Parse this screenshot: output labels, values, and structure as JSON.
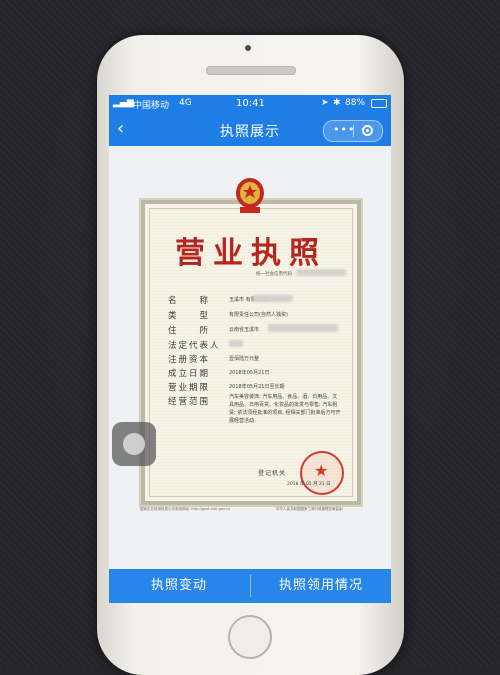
{
  "status": {
    "carrier": "中国移动",
    "network": "4G",
    "time": "10:41",
    "battery": "88%"
  },
  "nav": {
    "back": "‹",
    "title": "执照展示",
    "menu_dots": "•••"
  },
  "certificate": {
    "title": "营业执照",
    "credit_label": "统一社会信用代码",
    "rows": [
      {
        "label": "名　　称",
        "value": "玉溪市                    有限公司"
      },
      {
        "label": "类　　型",
        "value": "有限责任公司(自然人独资)"
      },
      {
        "label": "住　　所",
        "value": "云南省玉溪市"
      },
      {
        "label": "法定代表人",
        "value": ""
      },
      {
        "label": "注册资本",
        "value": "壹佰陆万元整"
      },
      {
        "label": "成立日期",
        "value": "2018年05月21日"
      },
      {
        "label": "营业期限",
        "value": "2018年05月21日至长期"
      },
      {
        "label": "经营范围",
        "value": ""
      }
    ],
    "scope": "汽车美容装饰; 汽车用品、食品、酒、日用品、文具用品、日用百货、化妆品的批发与零售; 汽车租赁; 依法须经批准的项目, 经相关部门批准后方可开展经营活动",
    "registrar": "登记机关",
    "reg_date": "2018 年 05 月 21 日",
    "footer_url": "国家企业信用信息公示系统网址: http://gsxt.saic.gov.cn",
    "footer_right": "中华人民共和国国家工商行政管理总局监制"
  },
  "tabs": {
    "left": "执照变动",
    "right": "执照领用情况"
  },
  "colors": {
    "brand_blue": "#1f7ee6",
    "title_red": "#b7261e"
  }
}
